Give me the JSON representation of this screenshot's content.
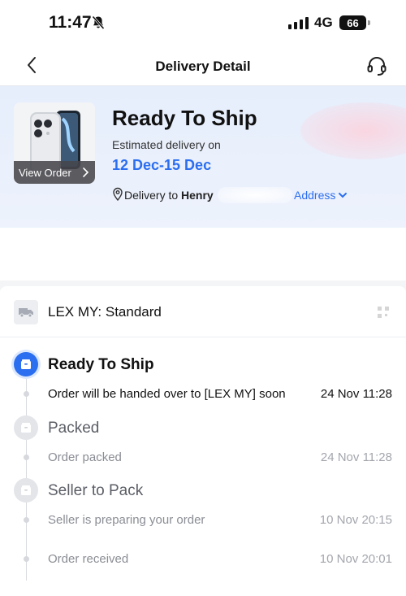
{
  "status_bar": {
    "time": "11:47",
    "network": "4G",
    "battery": "66"
  },
  "nav": {
    "title": "Delivery Detail"
  },
  "hero": {
    "status_title": "Ready To Ship",
    "estimated_label": "Estimated delivery on",
    "estimated_date": "12 Dec-15 Dec",
    "delivery_to_label": "Delivery to",
    "recipient": "Henry",
    "address_link": "Address",
    "view_order_label": "View Order"
  },
  "carrier": {
    "name": "LEX MY: Standard"
  },
  "timeline": [
    {
      "title": "Ready To Ship",
      "state": "active",
      "entries": [
        {
          "text": "Order will be handed over to [LEX MY] soon",
          "time": "24 Nov 11:28"
        }
      ]
    },
    {
      "title": "Packed",
      "state": "inactive",
      "entries": [
        {
          "text": "Order packed",
          "time": "24 Nov 11:28"
        }
      ]
    },
    {
      "title": "Seller to Pack",
      "state": "inactive",
      "entries": [
        {
          "text": "Seller is preparing your order",
          "time": "10 Nov 20:15"
        },
        {
          "text": "Order received",
          "time": "10 Nov 20:01"
        }
      ]
    }
  ],
  "colors": {
    "accent": "#2b6ef0",
    "hero_bg": "#e6eefc"
  },
  "icons": {
    "back": "chevron-left-icon",
    "support": "headset-icon",
    "mute": "bell-slash-icon",
    "location": "pin-icon",
    "carrier": "truck-icon",
    "status": "package-icon"
  }
}
